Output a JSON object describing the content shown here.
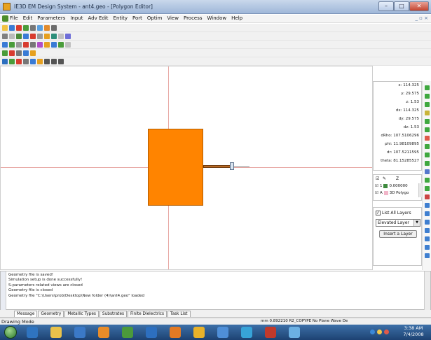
{
  "window": {
    "title": "IE3D EM Design System - ant4.geo - [Polygon Editor]",
    "controls": {
      "minimize": "–",
      "maximize": "□",
      "close": "✕"
    }
  },
  "menu": {
    "items": [
      "File",
      "Edit",
      "Parameters",
      "Input",
      "Adv Edit",
      "Entity",
      "Port",
      "Optim",
      "View",
      "Process",
      "Window",
      "Help"
    ],
    "mdi_controls": "_ ▫ ×"
  },
  "toolbars": {
    "row_icon_colors": [
      [
        "#f0c242",
        "#3a7bd5",
        "#d83c2f",
        "#4a9c3a",
        "#777777",
        "#5aa0e0",
        "#e28b2c",
        "#6c6c6c"
      ],
      [
        "#808080",
        "#bbbbbb",
        "#4c8b3a",
        "#3a7bd5",
        "#d83c2f",
        "#9a9a9a",
        "#e6a020",
        "#2d8f7b",
        "#c0c0c0",
        "#6e6ed8"
      ],
      [
        "#3a7bd5",
        "#4a9c3a",
        "#999999",
        "#d83c2f",
        "#777777",
        "#b04fc8",
        "#e6a020",
        "#3a7bd5",
        "#4a9c3a",
        "#c0c0c0"
      ],
      [
        "#4a9c3a",
        "#d83c2f",
        "#777777",
        "#3a7bd5",
        "#e6a020"
      ],
      [
        "#2d6fbf",
        "#4a9c3a",
        "#d83c2f",
        "#777777",
        "#3a7bd5",
        "#e6a020",
        "#555555",
        "#555555",
        "#555555"
      ]
    ]
  },
  "canvas": {
    "polygon_color": "#ff8400",
    "axis_color": "#e7a7a3",
    "port_label": ""
  },
  "coordinates": {
    "x": "x: 114.325",
    "y": "y: 29.575",
    "z": "z: 1.53",
    "dx": "dx: 114.325",
    "dy": "dy: 29.575",
    "dz": "dz: 1.53",
    "dRho": "dRho: 107.5106296",
    "phi": "phi: 11.98109895",
    "dr": "dr: 107.5211595",
    "theta": "theta: 81.15285527"
  },
  "layers": {
    "header_z": "Z",
    "rows": [
      {
        "index": "1",
        "value": "0.000000",
        "swatch": "#3d8a3d"
      },
      {
        "index": "A",
        "value": "3D Polygo",
        "swatch": "#f1b5c8"
      }
    ]
  },
  "layer_controls": {
    "list_all_label": "List All Layers",
    "list_all_checked": true,
    "select_value": "Elevated Layer",
    "insert_button": "Insert a Layer"
  },
  "messages": [
    "Geometry file is saved!",
    "Simulation setup is done successfully!",
    "S-parameters related views are closed",
    "Geometry file is closed",
    "Geometry file \"C:\\Users\\prob\\Desktop\\New folder (4)\\ant4.geo\" loaded"
  ],
  "tabs": [
    "Message",
    "Geometry",
    "Metallic Types",
    "Substrates",
    "Finite Dielectrics",
    "Task List"
  ],
  "active_tab": "Message",
  "status": {
    "mode": "Drawing Mode",
    "right": "mm  0.892210 R2_COPYPE No Plane Wave De"
  },
  "taskbar": {
    "app_colors": [
      "#2f74c0",
      "#e8c24b",
      "#3b79c7",
      "#e88c2a",
      "#4b9a3b",
      "#2d6fbf",
      "#e37a24",
      "#e8b22a",
      "#4f8fd8",
      "#37a3d8",
      "#c1392b",
      "#6bb0e3"
    ],
    "time": "3:38 AM",
    "date": "7/4/2008"
  }
}
